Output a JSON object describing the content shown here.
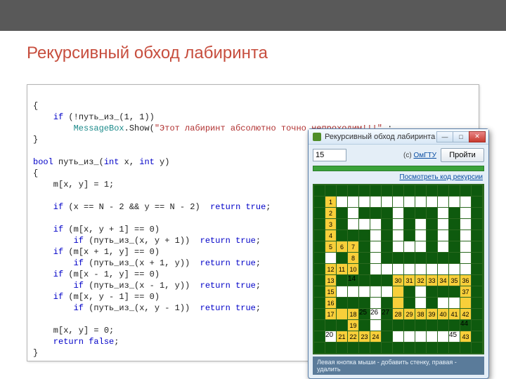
{
  "slide": {
    "title": "Рекурсивный обход лабиринта"
  },
  "code": {
    "l0": "{",
    "l1a": "if",
    "l1b": " (!путь_из_(1, 1))",
    "l2a": "MessageBox",
    "l2b": ".Show(",
    "l2c": "\"Этот лабиринт абсолютно точно непроходим!!!\"",
    "l2d": " ;",
    "l3": "}",
    "l5a": "bool",
    "l5b": " путь_из_(",
    "l5c": "int",
    "l5d": " x, ",
    "l5e": "int",
    "l5f": " y)",
    "l6": "{",
    "l7": "    m[x, y] = 1;",
    "l9a": "    if",
    "l9b": " (x == N - 2 && y == N - 2)  ",
    "l9c": "return true",
    "l9d": ";",
    "l11a": "    if",
    "l11b": " (m[x, y + 1] == 0)",
    "l12a": "        if",
    "l12b": " (путь_из_(x, y + 1))  ",
    "l12c": "return true",
    "l12d": ";",
    "l13a": "    if",
    "l13b": " (m[x + 1, y] == 0)",
    "l14a": "        if",
    "l14b": " (путь_из_(x + 1, y))  ",
    "l14c": "return true",
    "l14d": ";",
    "l15a": "    if",
    "l15b": " (m[x - 1, y] == 0)",
    "l16a": "        if",
    "l16b": " (путь_из_(x - 1, y))  ",
    "l16c": "return true",
    "l16d": ";",
    "l17a": "    if",
    "l17b": " (m[x, y - 1] == 0)",
    "l18a": "        if",
    "l18b": " (путь_из_(x, y - 1))  ",
    "l18c": "return true",
    "l18d": ";",
    "l20": "    m[x, y] = 0;",
    "l21a": "    return false",
    "l21b": ";",
    "l22": "}"
  },
  "app": {
    "window_title": "Рекурсивный обход лабиринта",
    "size_value": "15",
    "credit_label": "(c)",
    "credit_link": "ОмГТУ",
    "run_button": "Пройти",
    "view_code_link": "Посмотреть код рекурсии",
    "hint": "Левая кнопка мыши - добавить стенку, правая - удалить"
  },
  "maze": {
    "grid": [
      "WWWWWWWWWWWWWWW",
      "WV____________W",
      "WVW_WWW_WWW_W_W",
      "WVW___W_W_W_W_W",
      "WVWWW_W_W_W_W_W",
      "WVVVW_W___W_W_W",
      "W_WVW_WWWWWWW_W",
      "WVVVW_________W",
      "WVWWWWWVVVVVVVW",
      "WV_____VW_WWWVW",
      "WVWWW_WVW_W__VW",
      "WVVVW_WVVVVVVVW",
      "WWWVW_WWWWWWWWW",
      "W_VVVVW______VW",
      "WWWWWWWWWWWWWWW"
    ],
    "numbers": {
      "1,1": "1",
      "2,1": "2",
      "3,1": "3",
      "4,1": "4",
      "5,1": "5",
      "5,2": "6",
      "5,3": "7",
      "6,3": "8",
      "7,3": "10",
      "7,2": "11",
      "7,1": "12",
      "8,1": "13",
      "9,1": "15",
      "10,1": "16",
      "11,1": "17",
      "8,3": "14",
      "11,3": "18",
      "12,3": "19",
      "13,1": "20",
      "13,2": "21",
      "13,3": "22",
      "13,4": "23",
      "13,5": "24",
      "11,4": "25",
      "11,5": "26",
      "11,6": "27",
      "11,7": "28",
      "8,7": "30",
      "8,8": "31",
      "8,9": "32",
      "8,10": "33",
      "8,11": "34",
      "8,12": "35",
      "8,13": "36",
      "9,13": "37",
      "11,8": "29",
      "11,9": "38",
      "11,10": "39",
      "11,11": "40",
      "11,12": "41",
      "11,13": "42",
      "13,13": "43",
      "12,13": "44",
      "13,12": "45"
    }
  }
}
